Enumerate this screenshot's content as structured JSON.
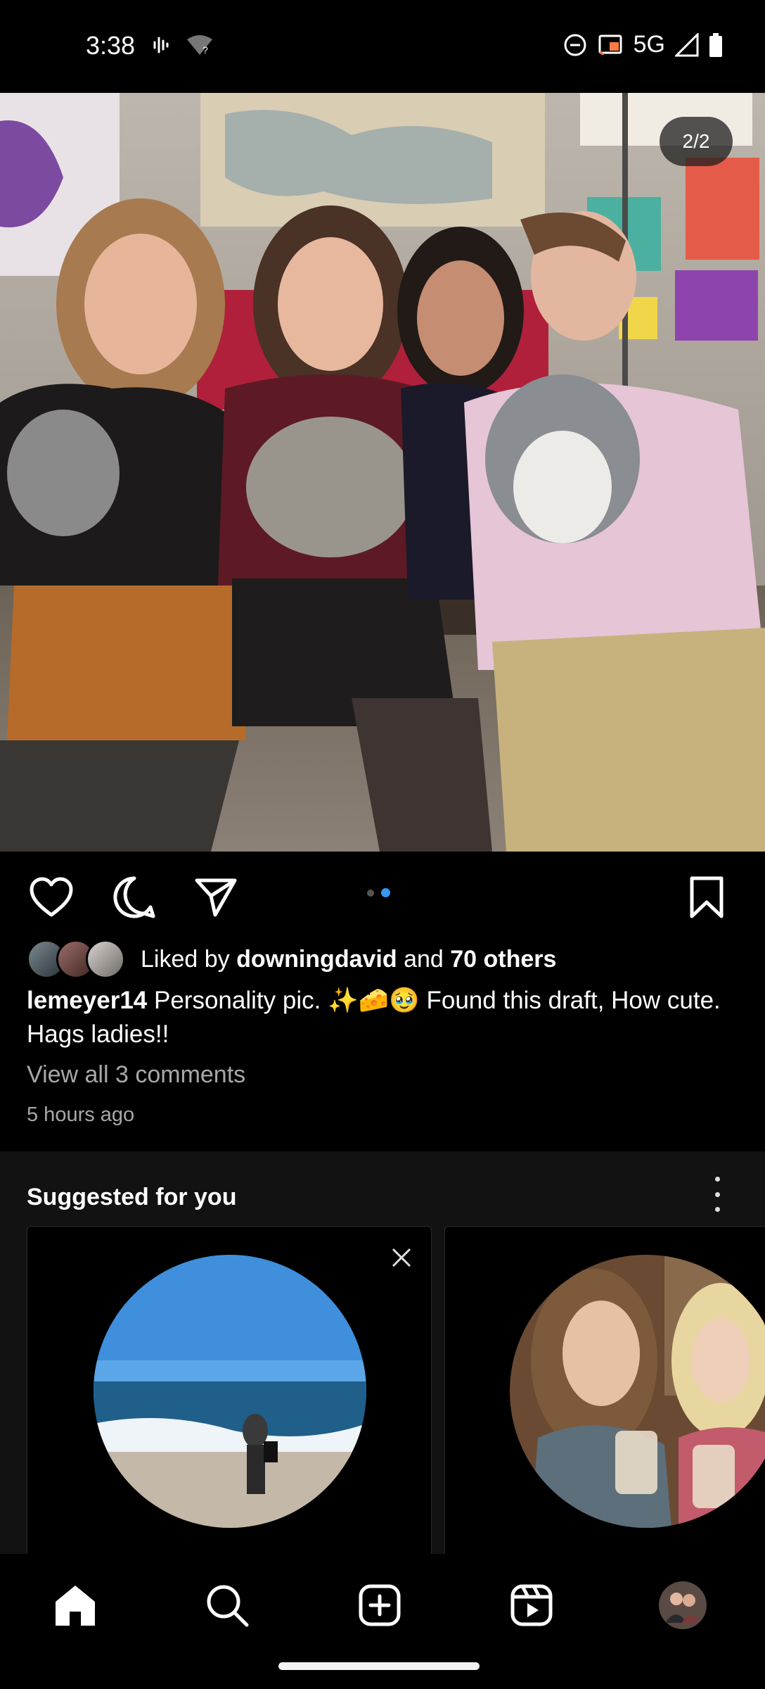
{
  "status_bar": {
    "time": "3:38",
    "network": "5G",
    "icons": [
      "voicemail-icon",
      "wifi-question-icon",
      "do-not-disturb-icon",
      "cast-icon",
      "signal-icon",
      "battery-icon"
    ]
  },
  "post": {
    "counter": "2/2",
    "carousel": {
      "count": 2,
      "active_index": 1
    },
    "liked_by_prefix": "Liked by ",
    "liked_by_user": "downingdavid",
    "liked_by_and": " and ",
    "liked_by_others": "70 others",
    "username": "lemeyer14",
    "caption": " Personality pic. ✨🧀🥹 Found this draft, How cute. Hags ladies!!",
    "view_comments": "View all 3 comments",
    "time_ago": "5 hours ago",
    "action_icons": [
      "heart-icon",
      "comment-icon",
      "share-icon",
      "bookmark-icon"
    ]
  },
  "suggested": {
    "title": "Suggested for you"
  },
  "bottom_nav": [
    "home-icon",
    "search-icon",
    "create-icon",
    "reels-icon",
    "profile-avatar"
  ],
  "colors": {
    "background": "#000000",
    "accent": "#3897f0",
    "secondary_text": "#a8a8a8",
    "section_bg": "#121212"
  }
}
